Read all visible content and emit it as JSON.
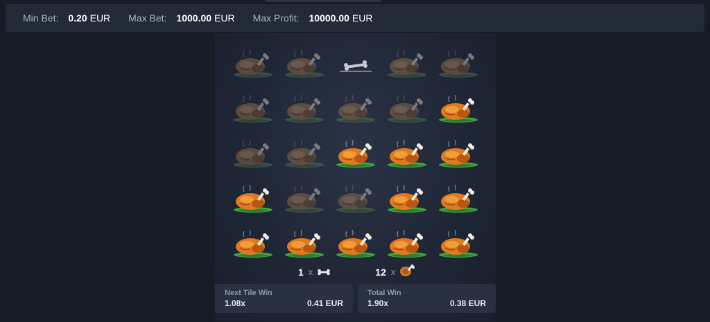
{
  "limits": {
    "min_bet_label": "Min Bet:",
    "min_bet_value": "0.20",
    "min_bet_currency": "EUR",
    "max_bet_label": "Max Bet:",
    "max_bet_value": "1000.00",
    "max_bet_currency": "EUR",
    "max_profit_label": "Max Profit:",
    "max_profit_value": "10000.00",
    "max_profit_currency": "EUR"
  },
  "board": {
    "rows": [
      [
        "chicken-dim",
        "chicken-dim",
        "bone",
        "chicken-dim",
        "chicken-dim"
      ],
      [
        "chicken-dim",
        "chicken-dim",
        "chicken-dim",
        "chicken-dim",
        "chicken"
      ],
      [
        "chicken-dim",
        "chicken-dim",
        "chicken",
        "chicken",
        "chicken"
      ],
      [
        "chicken",
        "chicken-dim",
        "chicken-dim",
        "chicken",
        "chicken"
      ],
      [
        "chicken",
        "chicken",
        "chicken",
        "chicken",
        "chicken"
      ]
    ]
  },
  "counts": {
    "bones": "1",
    "bones_x": "x",
    "chickens": "12",
    "chickens_x": "x"
  },
  "next_tile": {
    "label": "Next Tile Win",
    "multiplier": "1.08x",
    "amount": "0.41 EUR"
  },
  "total_win": {
    "label": "Total Win",
    "multiplier": "1.90x",
    "amount": "0.38 EUR"
  },
  "colors": {
    "background": "#161b26",
    "bar": "#222a38",
    "card": "#283041",
    "chicken": "#e07a1f",
    "grass": "#3fa43a"
  }
}
